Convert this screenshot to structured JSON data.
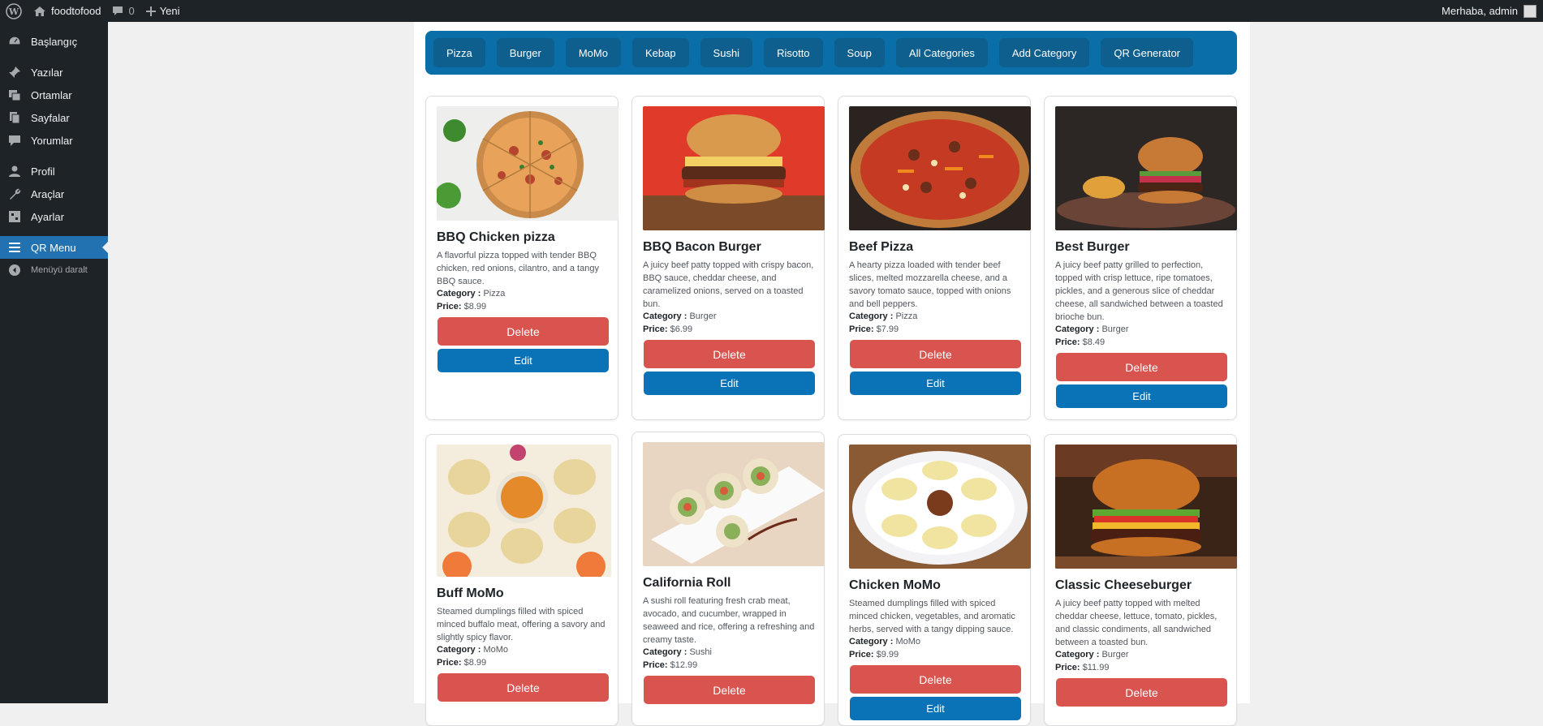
{
  "adminbar": {
    "site_name": "foodtofood",
    "comments_count": "0",
    "new_label": "Yeni",
    "greeting": "Merhaba, admin"
  },
  "sidebar": {
    "items": [
      {
        "label": "Başlangıç",
        "icon": "dashboard-icon"
      },
      {
        "label": "Yazılar",
        "icon": "pin-icon"
      },
      {
        "label": "Ortamlar",
        "icon": "media-icon"
      },
      {
        "label": "Sayfalar",
        "icon": "pages-icon"
      },
      {
        "label": "Yorumlar",
        "icon": "comment-icon"
      },
      {
        "label": "Profil",
        "icon": "user-icon"
      },
      {
        "label": "Araçlar",
        "icon": "wrench-icon"
      },
      {
        "label": "Ayarlar",
        "icon": "settings-icon"
      },
      {
        "label": "QR Menu",
        "icon": "menu-icon"
      },
      {
        "label": "Menüyü daralt",
        "icon": "collapse-icon"
      }
    ]
  },
  "categories": [
    "Pizza",
    "Burger",
    "MoMo",
    "Kebap",
    "Sushi",
    "Risotto",
    "Soup",
    "All Categories",
    "Add Category",
    "QR Generator"
  ],
  "labels": {
    "category": "Category :",
    "price": "Price:",
    "delete": "Delete",
    "edit": "Edit"
  },
  "products": [
    {
      "name": "BBQ Chicken pizza",
      "description": "A flavorful pizza topped with tender BBQ chicken, red onions, cilantro, and a tangy BBQ sauce.",
      "category": "Pizza",
      "price": "$8.99"
    },
    {
      "name": "BBQ Bacon Burger",
      "description": "A juicy beef patty topped with crispy bacon, BBQ sauce, cheddar cheese, and caramelized onions, served on a toasted bun.",
      "category": "Burger",
      "price": "$6.99"
    },
    {
      "name": "Beef Pizza",
      "description": "A hearty pizza loaded with tender beef slices, melted mozzarella cheese, and a savory tomato sauce, topped with onions and bell peppers.",
      "category": "Pizza",
      "price": "$7.99"
    },
    {
      "name": "Best Burger",
      "description": "A juicy beef patty grilled to perfection, topped with crisp lettuce, ripe tomatoes, pickles, and a generous slice of cheddar cheese, all sandwiched between a toasted brioche bun.",
      "category": "Burger",
      "price": "$8.49"
    },
    {
      "name": "Buff MoMo",
      "description": "Steamed dumplings filled with spiced minced buffalo meat, offering a savory and slightly spicy flavor.",
      "category": "MoMo",
      "price": "$8.99"
    },
    {
      "name": "California Roll",
      "description": "A sushi roll featuring fresh crab meat, avocado, and cucumber, wrapped in seaweed and rice, offering a refreshing and creamy taste.",
      "category": "Sushi",
      "price": "$12.99"
    },
    {
      "name": "Chicken MoMo",
      "description": "Steamed dumplings filled with spiced minced chicken, vegetables, and aromatic herbs, served with a tangy dipping sauce.",
      "category": "MoMo",
      "price": "$9.99"
    },
    {
      "name": "Classic Cheeseburger",
      "description": "A juicy beef patty topped with melted cheddar cheese, lettuce, tomato, pickles, and classic condiments, all sandwiched between a toasted bun.",
      "category": "Burger",
      "price": "$11.99"
    }
  ]
}
